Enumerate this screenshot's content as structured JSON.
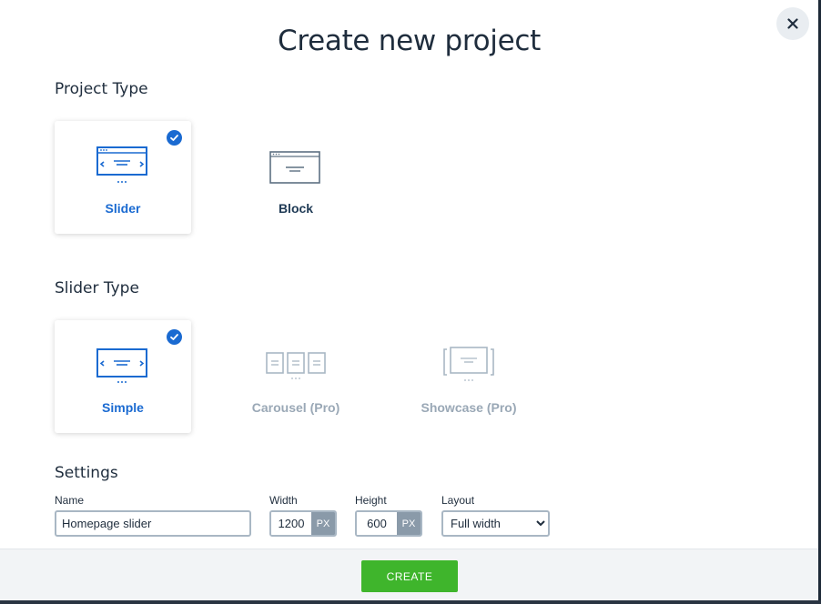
{
  "dialog": {
    "title": "Create new project",
    "close_icon": "close-icon"
  },
  "project_type": {
    "heading": "Project Type",
    "options": [
      {
        "label": "Slider",
        "icon": "slider-icon",
        "selected": true
      },
      {
        "label": "Block",
        "icon": "block-icon",
        "selected": false
      }
    ]
  },
  "slider_type": {
    "heading": "Slider Type",
    "options": [
      {
        "label": "Simple",
        "icon": "simple-slider-icon",
        "selected": true,
        "disabled": false
      },
      {
        "label": "Carousel (Pro)",
        "icon": "carousel-icon",
        "selected": false,
        "disabled": true
      },
      {
        "label": "Showcase (Pro)",
        "icon": "showcase-icon",
        "selected": false,
        "disabled": true
      }
    ]
  },
  "settings": {
    "heading": "Settings",
    "name_label": "Name",
    "name_value": "Homepage slider",
    "width_label": "Width",
    "width_value": "1200",
    "width_unit": "PX",
    "height_label": "Height",
    "height_value": "600",
    "height_unit": "PX",
    "layout_label": "Layout",
    "layout_value": "Full width"
  },
  "footer": {
    "create_label": "CREATE"
  },
  "colors": {
    "accent": "#1a6ad1",
    "create_button": "#3fb52c",
    "disabled": "#9aa8b6"
  }
}
